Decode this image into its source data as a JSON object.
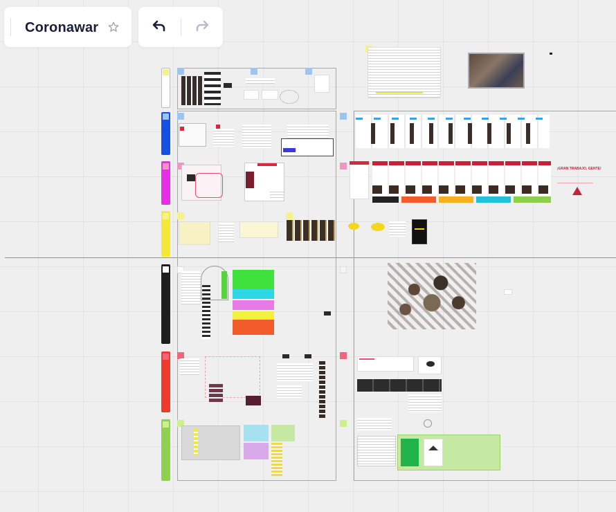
{
  "board": {
    "title": "Coronawar",
    "star_icon": "star-icon",
    "undo_icon": "undo-icon",
    "redo_icon": "redo-icon"
  },
  "canvas": {
    "headline_text": "¡GRAN TRABAJO, GENTE!",
    "section_colors": {
      "white": "#ffffff",
      "blue": "#1450e6",
      "magenta": "#e62ee6",
      "yellow": "#f5e83a",
      "black": "#1e1e1e",
      "red": "#ee3b2e",
      "green": "#8fd14f"
    },
    "accent_colors": {
      "sticky_yellow": "#f5f28a",
      "sticky_blue": "#9ec4f2",
      "sticky_pink": "#ef96c2",
      "sticky_red": "#f0667a",
      "sticky_lime": "#cdf08a",
      "band_black": "#222222",
      "band_orange": "#f25c2a",
      "band_yellow": "#f5b21e",
      "band_cyan": "#22c1d8",
      "band_green": "#8ccf4b"
    }
  }
}
